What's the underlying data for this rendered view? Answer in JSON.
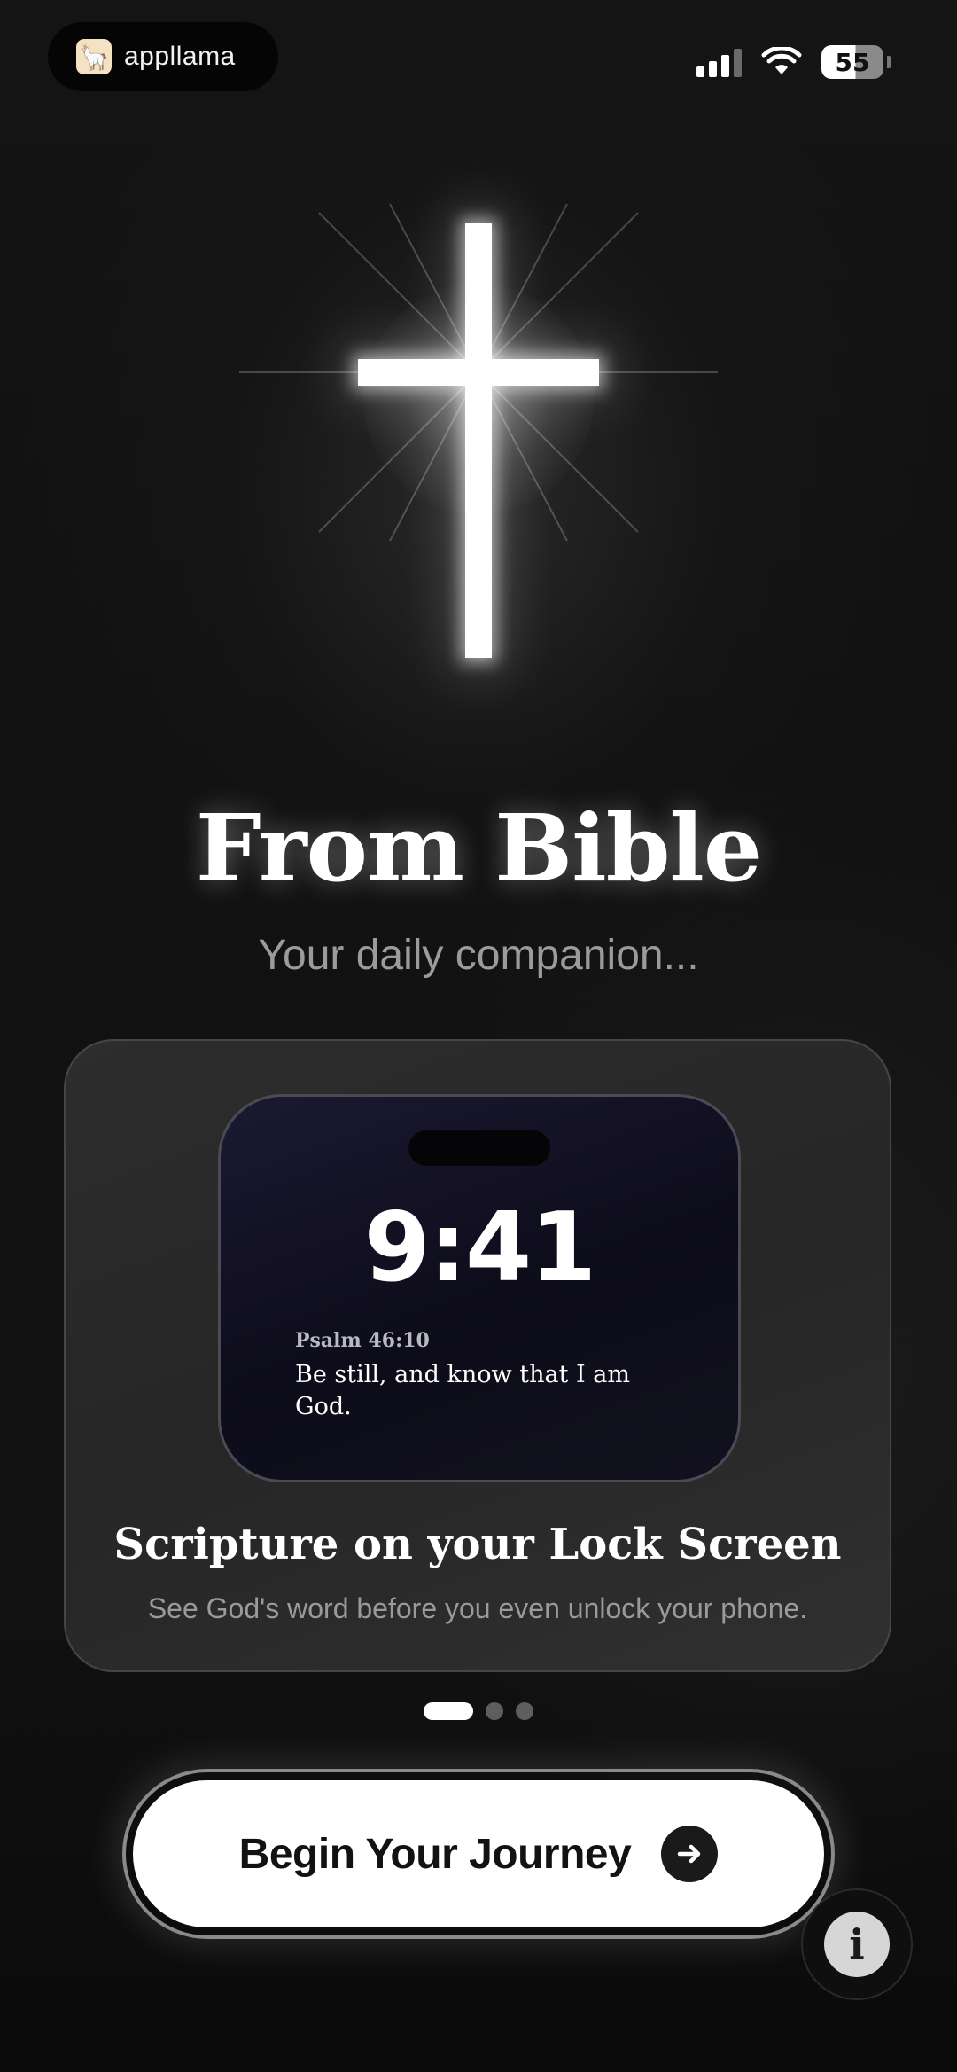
{
  "status_bar": {
    "app_name": "appllama",
    "battery": "55",
    "icons": [
      "signal-icon",
      "wifi-icon",
      "battery-icon"
    ]
  },
  "hero": {
    "icon": "cross-icon",
    "title": "From Bible",
    "subtitle": "Your daily companion..."
  },
  "feature_card": {
    "preview": {
      "time": "9:41",
      "verse_reference": "Psalm 46:10",
      "verse_text": "Be still, and know that I am God."
    },
    "title": "Scripture on your Lock Screen",
    "description": "See God's word before you even unlock your phone."
  },
  "pagination": {
    "total": 3,
    "active_index": 0
  },
  "cta": {
    "label": "Begin Your Journey",
    "icon": "arrow-right-icon"
  },
  "info": {
    "icon": "info-icon",
    "glyph": "i"
  },
  "colors": {
    "background": "#111111",
    "accent": "#ffffff",
    "card": "#2b2b2b",
    "muted_text": "#9b9b9b"
  }
}
